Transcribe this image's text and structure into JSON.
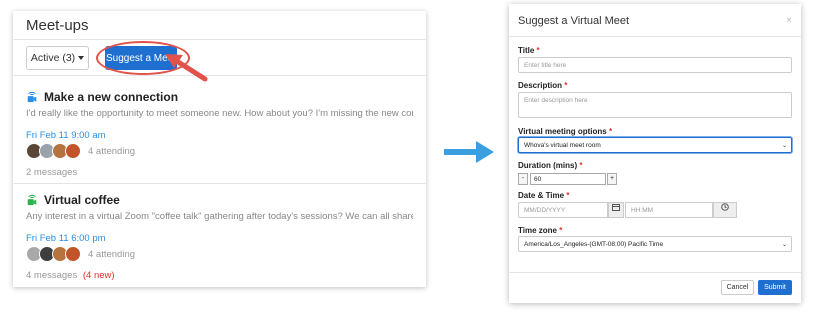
{
  "left_panel": {
    "title": "Meet-ups",
    "active_filter": "Active (3)",
    "suggest_button": "Suggest a Meet",
    "meetups": [
      {
        "title": "Make a new connection",
        "description": "I'd really like the opportunity to meet someone new. How about you? I'm missing the new connection",
        "date": "Fri Feb 11 9:00 am",
        "attending": "4 attending",
        "messages": "2 messages",
        "new_messages": ""
      },
      {
        "title": "Virtual coffee",
        "description": "Any interest in a virtual Zoom \"coffee talk\" gathering after today's sessions? We can all share a coffe",
        "date": "Fri Feb 11 6:00 pm",
        "attending": "4 attending",
        "messages": "4 messages",
        "new_messages": "(4 new)"
      }
    ]
  },
  "modal": {
    "title": "Suggest a Virtual Meet",
    "close_glyph": "×",
    "required_mark": "*",
    "fields": {
      "title_label": "Title",
      "title_placeholder": "Enter title here",
      "description_label": "Description",
      "description_placeholder": "Enter description here",
      "virtual_label": "Virtual meeting options",
      "virtual_value": "Whova's virtual meet room",
      "duration_label": "Duration (mins)",
      "duration_minus": "-",
      "duration_value": "60",
      "duration_plus": "+",
      "datetime_label": "Date & Time",
      "date_placeholder": "MM/DD/YYYY",
      "time_placeholder": "HH:MM",
      "timezone_label": "Time zone",
      "timezone_value": "America/Los_Angeles-(GMT-08:00) Pacific Time"
    },
    "cancel_button": "Cancel",
    "submit_button": "Submit"
  },
  "colors": {
    "primary": "#1f6fd1",
    "highlight_red": "#e0524a",
    "link_blue": "#2a8ee6",
    "camera_green": "#2bb24c",
    "arrow_blue": "#3a9ee0"
  },
  "icons": {
    "video_camera": "video-camera-icon",
    "calendar": "calendar-icon",
    "clock": "clock-icon",
    "caret": "caret-down-icon",
    "arrow": "arrow-right-icon"
  }
}
